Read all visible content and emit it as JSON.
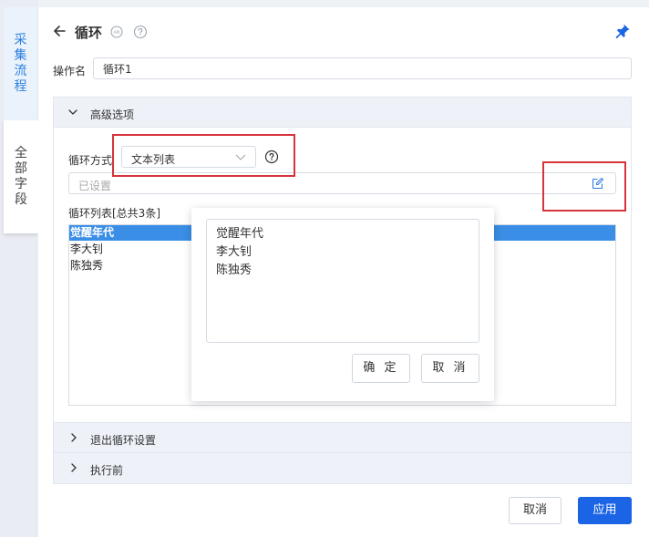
{
  "side_tabs": [
    {
      "label": [
        "采",
        "集",
        "流",
        "程"
      ],
      "active": true
    },
    {
      "label": [
        "全",
        "部",
        "字",
        "段"
      ],
      "active": false
    }
  ],
  "header": {
    "back_icon": "arrow-left-icon",
    "title": "循环",
    "api_icon": "api-badge-icon",
    "help_icon": "question-circle-icon",
    "pin_icon": "pin-icon"
  },
  "operation": {
    "label": "操作名",
    "value": "循环1"
  },
  "advanced": {
    "title": "高级选项",
    "loop_mode_label": "循环方式",
    "loop_mode_value": "文本列表",
    "set_field_value": "已设置",
    "list_label": "循环列表[总共3条]",
    "list_items": [
      "觉醒年代",
      "李大钊",
      "陈独秀"
    ],
    "selected_index": 0
  },
  "collapsed_sections": {
    "exit": "退出循环设置",
    "before": "执行前"
  },
  "popup": {
    "lines": [
      "觉醒年代",
      "李大钊",
      "陈独秀"
    ],
    "confirm": "确 定",
    "cancel": "取 消"
  },
  "footer": {
    "cancel": "取消",
    "apply": "应用"
  },
  "colors": {
    "accent": "#1c64e6",
    "selection": "#3a8ee6",
    "highlight": "#d6343a"
  }
}
